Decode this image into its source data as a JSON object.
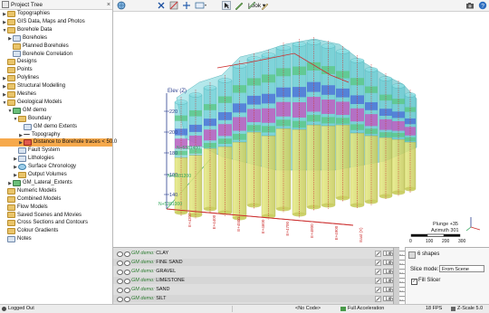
{
  "tree": {
    "title": "Project Tree",
    "close": "×",
    "items": [
      {
        "label": "Topographies",
        "icon": "folder",
        "twist": "▶",
        "depth": 0
      },
      {
        "label": "GIS Data, Maps and Photos",
        "icon": "folder",
        "twist": "▶",
        "depth": 0
      },
      {
        "label": "Borehole Data",
        "icon": "folder",
        "twist": "▼",
        "depth": 0
      },
      {
        "label": "Boreholes",
        "icon": "doc",
        "twist": "▶",
        "depth": 1
      },
      {
        "label": "Planned Boreholes",
        "icon": "folder",
        "twist": "",
        "depth": 1
      },
      {
        "label": "Borehole Correlation",
        "icon": "doc",
        "twist": "",
        "depth": 1
      },
      {
        "label": "Designs",
        "icon": "folder",
        "twist": "",
        "depth": 0
      },
      {
        "label": "Points",
        "icon": "folder",
        "twist": "",
        "depth": 0
      },
      {
        "label": "Polylines",
        "icon": "folder",
        "twist": "▶",
        "depth": 0
      },
      {
        "label": "Structural Modelling",
        "icon": "folder",
        "twist": "▶",
        "depth": 0
      },
      {
        "label": "Meshes",
        "icon": "folder",
        "twist": "▶",
        "depth": 0
      },
      {
        "label": "Geological Models",
        "icon": "folder",
        "twist": "▼",
        "depth": 0
      },
      {
        "label": "GM demo",
        "icon": "model",
        "twist": "▼",
        "depth": 1
      },
      {
        "label": "Boundary",
        "icon": "folder",
        "twist": "▼",
        "depth": 2
      },
      {
        "label": "GM demo Extents",
        "icon": "doc",
        "twist": "",
        "depth": 3
      },
      {
        "label": "Topography",
        "icon": "line",
        "twist": "▶",
        "depth": 3
      },
      {
        "label": "Distance to Borehole traces < 50.0",
        "icon": "red",
        "twist": "▶",
        "depth": 3,
        "selected": true
      },
      {
        "label": "Fault System",
        "icon": "doc",
        "twist": "",
        "depth": 2
      },
      {
        "label": "Lithologies",
        "icon": "doc",
        "twist": "▶",
        "depth": 2
      },
      {
        "label": "Surface Chronology",
        "icon": "eye",
        "twist": "▶",
        "depth": 2
      },
      {
        "label": "Output Volumes",
        "icon": "folder",
        "twist": "▶",
        "depth": 2
      },
      {
        "label": "GM_Lateral_Extents",
        "icon": "model",
        "twist": "▶",
        "depth": 1
      },
      {
        "label": "Numeric Models",
        "icon": "folder",
        "twist": "",
        "depth": 0
      },
      {
        "label": "Combined Models",
        "icon": "folder",
        "twist": "",
        "depth": 0
      },
      {
        "label": "Flow Models",
        "icon": "folder",
        "twist": "",
        "depth": 0
      },
      {
        "label": "Saved Scenes and Movies",
        "icon": "folder",
        "twist": "",
        "depth": 0
      },
      {
        "label": "Cross Sections and Contours",
        "icon": "folder",
        "twist": "",
        "depth": 0
      },
      {
        "label": "Colour Gradients",
        "icon": "folder",
        "twist": "",
        "depth": 0
      },
      {
        "label": "Notes",
        "icon": "doc",
        "twist": "",
        "depth": 0
      }
    ]
  },
  "toolbar": {
    "look_label": "Look ▾",
    "icons": [
      "globe-icon",
      "look-icon",
      "axis-icon",
      "slice-icon",
      "move-icon",
      "view-icon",
      "select-icon",
      "draw-icon",
      "ruler-icon",
      "pen-icon",
      "camera-icon",
      "help-icon"
    ]
  },
  "scene": {
    "axis_title": "Elev (Z)",
    "z_ticks": [
      "220",
      "200",
      "180",
      "160",
      "140"
    ],
    "north_labels": [
      "N+5381400",
      "N+5381200",
      "N+5381000"
    ],
    "east_labels": [
      "E+4300",
      "E+4400",
      "E+4500",
      "E+4600",
      "E+4700",
      "E+4800",
      "E+4900",
      "East (X)"
    ],
    "plunge": "Plunge +35",
    "azimuth": "Azimuth 301",
    "scale_ticks": [
      "0",
      "100",
      "200",
      "300"
    ],
    "colors": {
      "cyan": "#5bc9cf",
      "green": "#59c77f",
      "blue": "#4868d8",
      "magenta": "#c84fbe",
      "yellow": "#d9dd6b",
      "red": "#cc2e2e",
      "axis": "#2b3f8f"
    }
  },
  "shapes": {
    "rows": [
      {
        "model": "GM demo:",
        "name": "CLAY",
        "dd": "Litholo...",
        "color": "#71d04e"
      },
      {
        "model": "GM demo:",
        "name": "FINE SAND",
        "dd": "Litholo...",
        "color": "#2fb0a8"
      },
      {
        "model": "GM demo:",
        "name": "GRAVEL",
        "dd": "Litholo...",
        "color": "#3c64e0"
      },
      {
        "model": "GM demo:",
        "name": "LIMESTONE",
        "dd": "Litholo...",
        "color": "#d056c8"
      },
      {
        "model": "GM demo:",
        "name": "SAND",
        "dd": "Litholo...",
        "color": "#e8ec6c"
      },
      {
        "model": "GM demo:",
        "name": "SILT",
        "dd": "Litholo...",
        "color": "#dcdcdc"
      }
    ]
  },
  "props": {
    "title": "6 shapes",
    "slice_label": "Slice mode:",
    "slice_value": "From Scene",
    "fill_label": "Fill Slicer"
  },
  "status": {
    "logged": "Logged Out",
    "code": "<No Code>",
    "accel": "Full Acceleration",
    "fps": "18 FPS",
    "zscale": "Z-Scale 5.0"
  }
}
